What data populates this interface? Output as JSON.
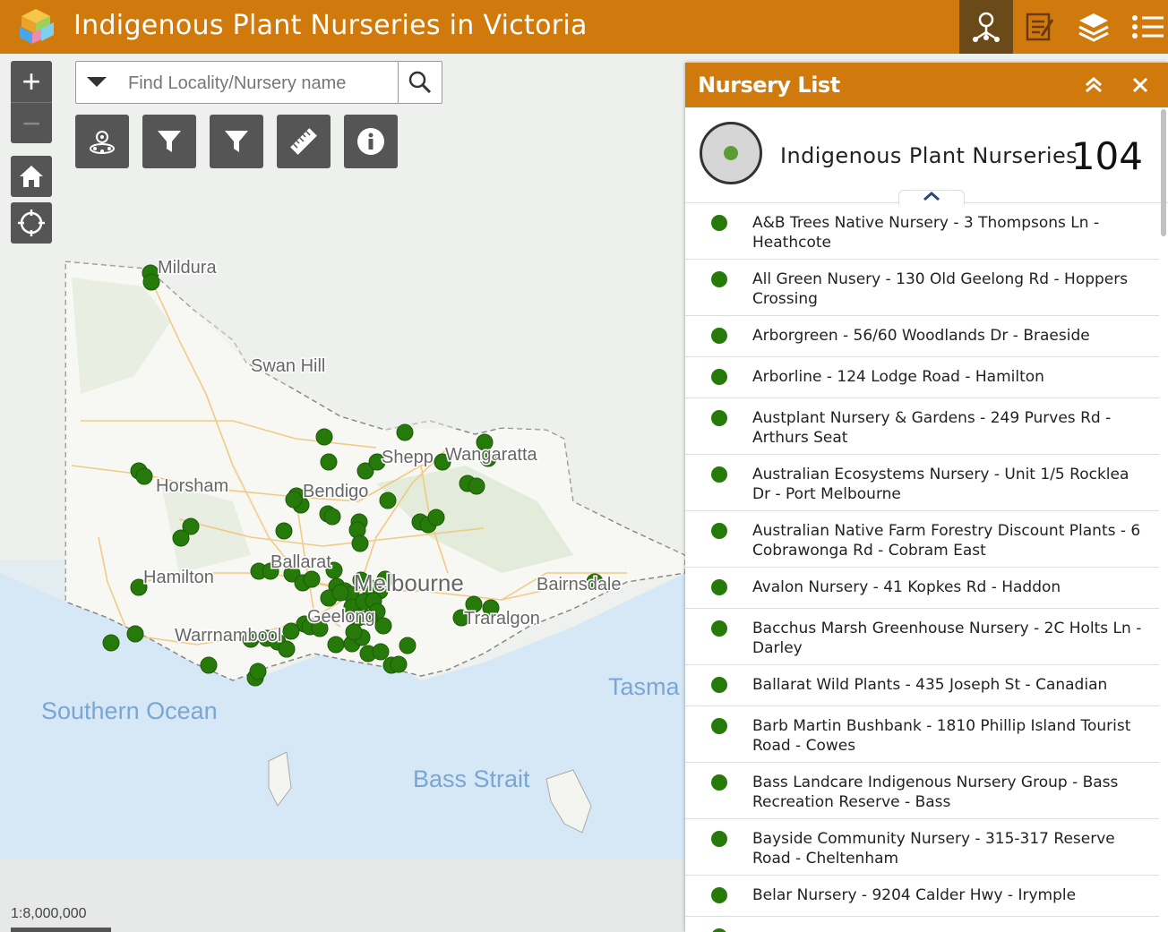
{
  "header": {
    "title": "Indigenous Plant Nurseries in Victoria",
    "background_color": "#d07a0e",
    "buttons": [
      {
        "icon": "nursery-locator-icon",
        "active": true
      },
      {
        "icon": "report-icon",
        "active": false
      },
      {
        "icon": "layers-icon",
        "active": false
      },
      {
        "icon": "list-icon",
        "active": false
      }
    ]
  },
  "map": {
    "zoom_in": "+",
    "zoom_out": "−",
    "scale_text": "1:8,000,000",
    "labels": {
      "mildura": "Mildura",
      "swan_hill": "Swan Hill",
      "shepparton": "Shepp",
      "wangaratta": "Wangaratta",
      "horsham": "Horsham",
      "bendigo": "Bendigo",
      "ballarat": "Ballarat",
      "melbourne": "Melbourne",
      "hamilton": "Hamilton",
      "bairnsdale": "Bairnsdale",
      "geelong": "Geelong",
      "traralgon": "Traralgon",
      "warrnambool": "Warrnambool",
      "tasman": "Tasma",
      "southern_ocean": "Southern Ocean",
      "bass_strait": "Bass Strait"
    },
    "point_color": "#267a0a"
  },
  "search": {
    "placeholder": "Find Locality/Nursery name"
  },
  "tools": [
    "nursery-locator-icon",
    "filter-icon",
    "filter-icon",
    "measure-icon",
    "info-icon"
  ],
  "panel": {
    "title": "Nursery List",
    "layer": {
      "name": "Indigenous Plant Nurseries",
      "count": "104"
    },
    "items": [
      {
        "text": "A&B Trees Native Nursery - 3 Thompsons Ln - Heathcote"
      },
      {
        "text": "All Green Nusery - 130 Old Geelong Rd - Hoppers Crossing"
      },
      {
        "text": "Arborgreen - 56/60 Woodlands Dr - Braeside"
      },
      {
        "text": "Arborline - 124 Lodge Road - Hamilton"
      },
      {
        "text": "Austplant Nursery & Gardens -  249 Purves Rd - Arthurs Seat"
      },
      {
        "text": "Australian Ecosystems Nursery - Unit 1/5 Rocklea Dr - Port Melbourne"
      },
      {
        "text": "Australian Native Farm Forestry Discount Plants - 6 Cobrawonga Rd - Cobram East"
      },
      {
        "text": "Avalon Nursery - 41 Kopkes Rd - Haddon"
      },
      {
        "text": "Bacchus Marsh Greenhouse Nursery - 2C Holts Ln - Darley"
      },
      {
        "text": "Ballarat Wild Plants - 435 Joseph St - Canadian"
      },
      {
        "text": "Barb Martin Bushbank - 1810 Phillip Island Tourist Road - Cowes"
      },
      {
        "text": "Bass Landcare Indigenous Nursery Group - Bass Recreation Reserve - Bass"
      },
      {
        "text": "Bayside Community Nursery - 315-317 Reserve Road - Cheltenham"
      },
      {
        "text": "Belar Nursery - 9204 Calder Hwy - Irymple"
      }
    ]
  }
}
